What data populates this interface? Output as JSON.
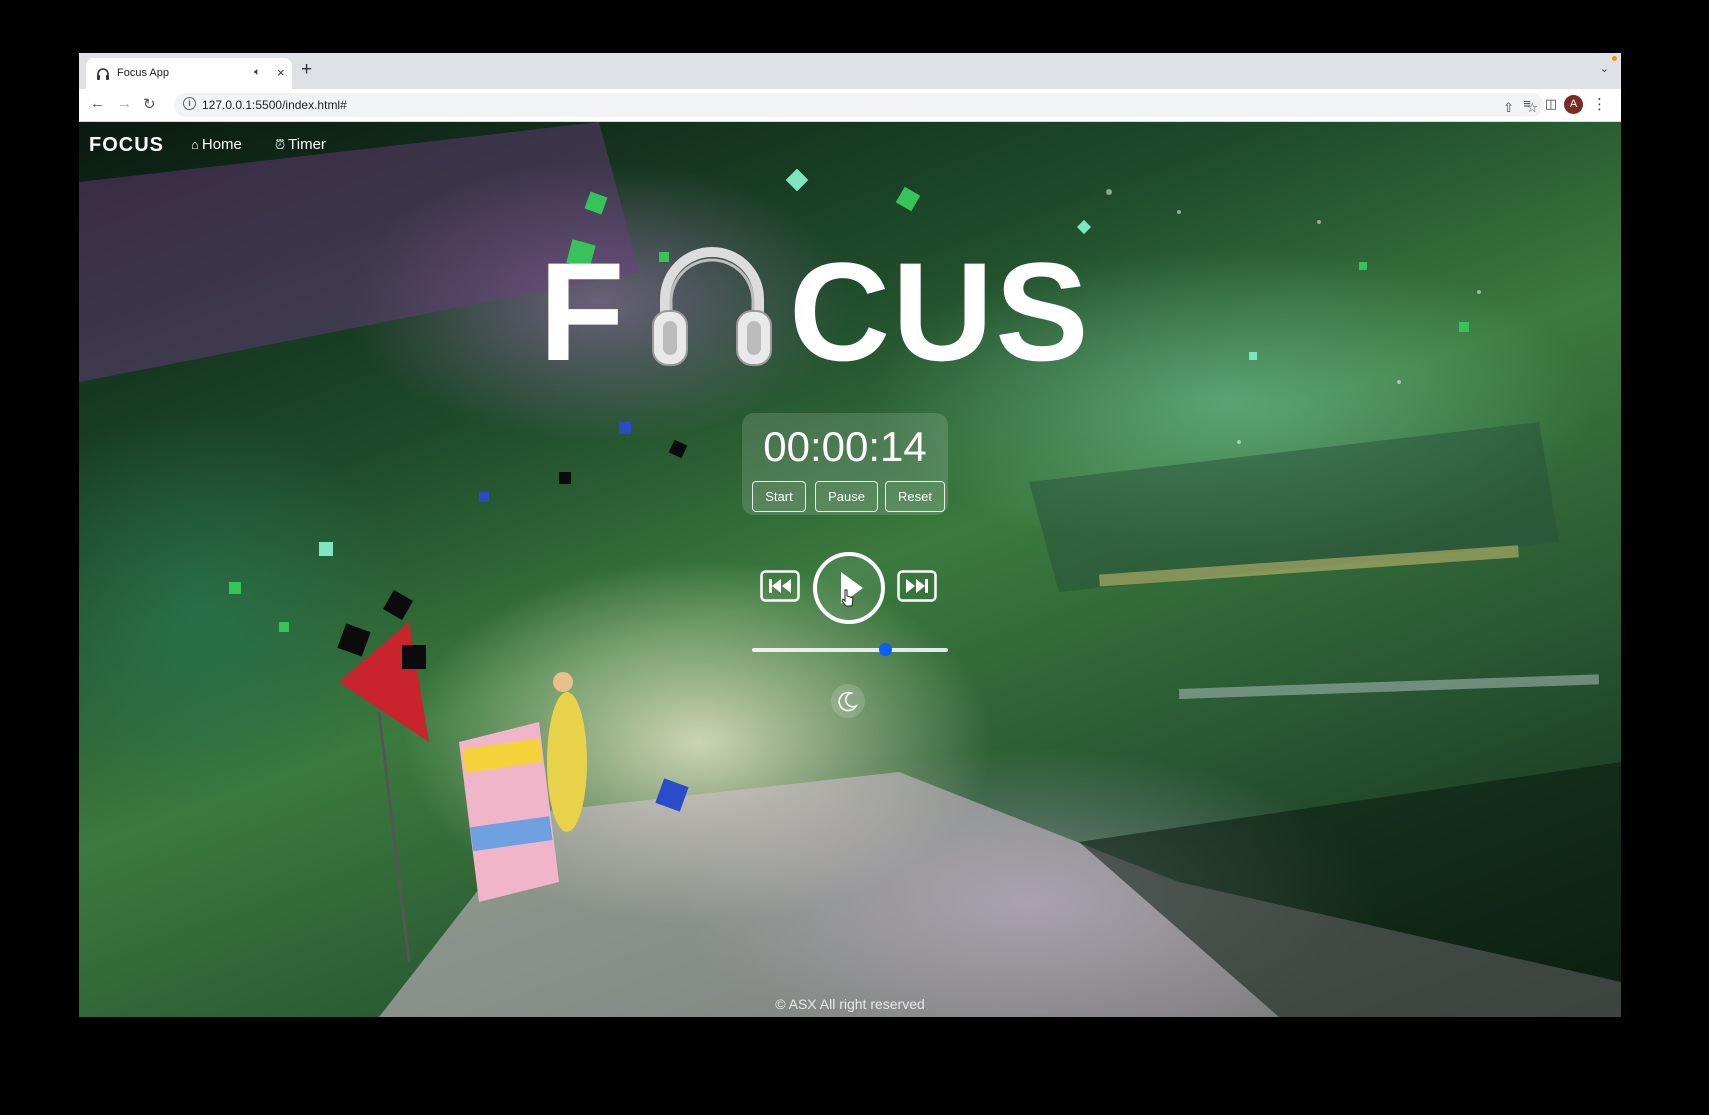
{
  "browser": {
    "tab_title": "Focus App",
    "url": "127.0.0.1:5500/index.html#",
    "profile_initial": "A",
    "new_tab_symbol": "+",
    "close_symbol": "×",
    "mute_icon": "speaker-muted-icon"
  },
  "nav": {
    "brand": "FOCUS",
    "links": [
      {
        "label": "Home",
        "icon": "home-icon"
      },
      {
        "label": "Timer",
        "icon": "alarm-clock-icon"
      }
    ]
  },
  "hero": {
    "letters": [
      "F",
      "CUS"
    ],
    "logo_icon": "headphones-icon"
  },
  "timer": {
    "display": "00:00:14",
    "buttons": {
      "start": "Start",
      "pause": "Pause",
      "reset": "Reset"
    }
  },
  "player": {
    "state": "paused",
    "volume_percent": 68,
    "accent_color": "#0a5fff"
  },
  "theme_toggle": {
    "icon": "moon-icon"
  },
  "footer": {
    "text": "© ASX All right reserved"
  }
}
